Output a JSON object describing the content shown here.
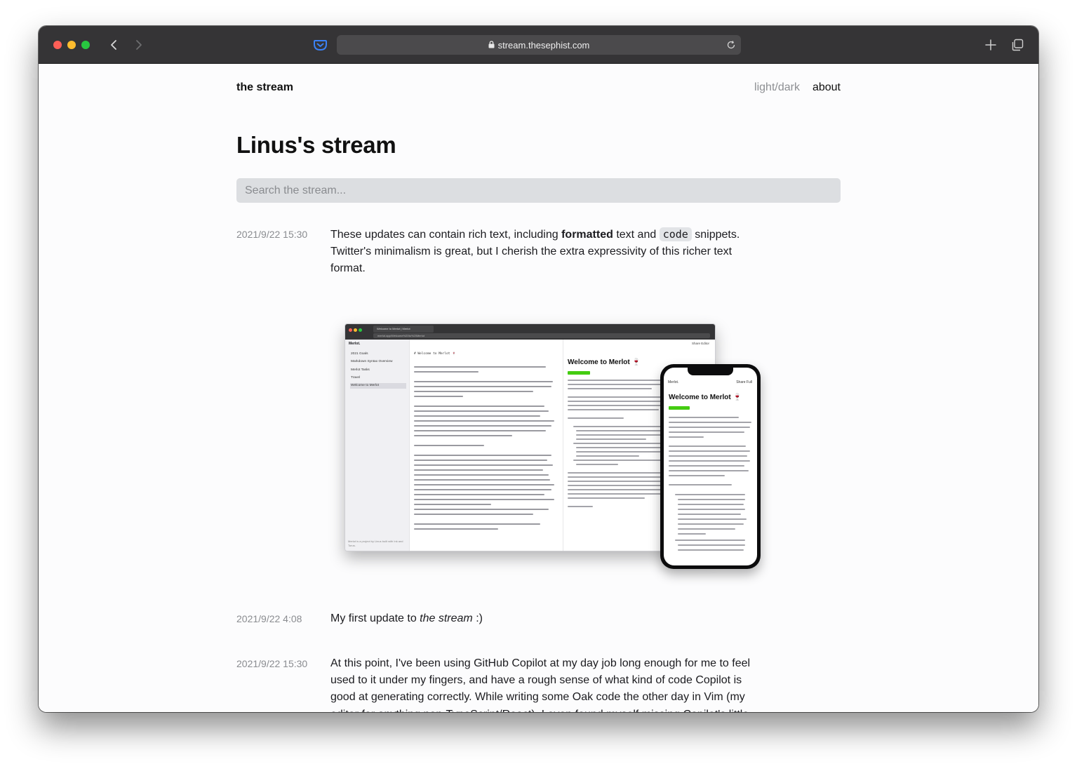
{
  "browser": {
    "url": "stream.thesephist.com"
  },
  "site": {
    "title": "the stream",
    "nav": {
      "theme_toggle": "light/dark",
      "about": "about"
    }
  },
  "page": {
    "heading": "Linus's stream",
    "search_placeholder": "Search the stream..."
  },
  "entries": [
    {
      "date": "2021/9/22 15:30",
      "text_before_bold": "These updates can contain rich text, including ",
      "bold": "formatted",
      "text_mid": " text and ",
      "code": "code",
      "text_after": " snippets. Twitter's minimalism is great, but I cherish the extra expressivity of this richer text format."
    },
    {
      "date": "2021/9/22 4:08",
      "text_before_italic": "My first update to ",
      "italic": "the stream",
      "text_after": " :)"
    },
    {
      "date": "2021/9/22 15:30",
      "text": "At this point, I've been using GitHub Copilot at my day job long enough for me to feel used to it under my fingers, and have a rough sense of what kind of code Copilot is good at generating correctly. While writing some Oak code the other day in Vim (my editor for anything non-TypeScript/React), I even found myself missing Copilot's little grey type-ahead hints to stamp out some repetitive bit of code it surely would have"
    }
  ],
  "screenshot": {
    "tab_title": "Welcome to Merlot | Merlot",
    "url": "merlot.app/Welcome%20to%20Merlot",
    "app_name": "Merlot.",
    "sidebar_items": [
      "2021 Goals",
      "Markdown Syntax Overview",
      "Merlot Tasks",
      "Travel",
      "Welcome to Merlot"
    ],
    "sidebar_footer": "Merlot is a project by Linus built with Ink and Torus.",
    "editor_heading": "# Welcome to Merlot 🍷",
    "toolbar": "Share   Editor",
    "preview_title": "Welcome to Merlot 🍷",
    "phone_toolbar": "Share   Full",
    "phone_title": "Welcome to Merlot 🍷"
  }
}
